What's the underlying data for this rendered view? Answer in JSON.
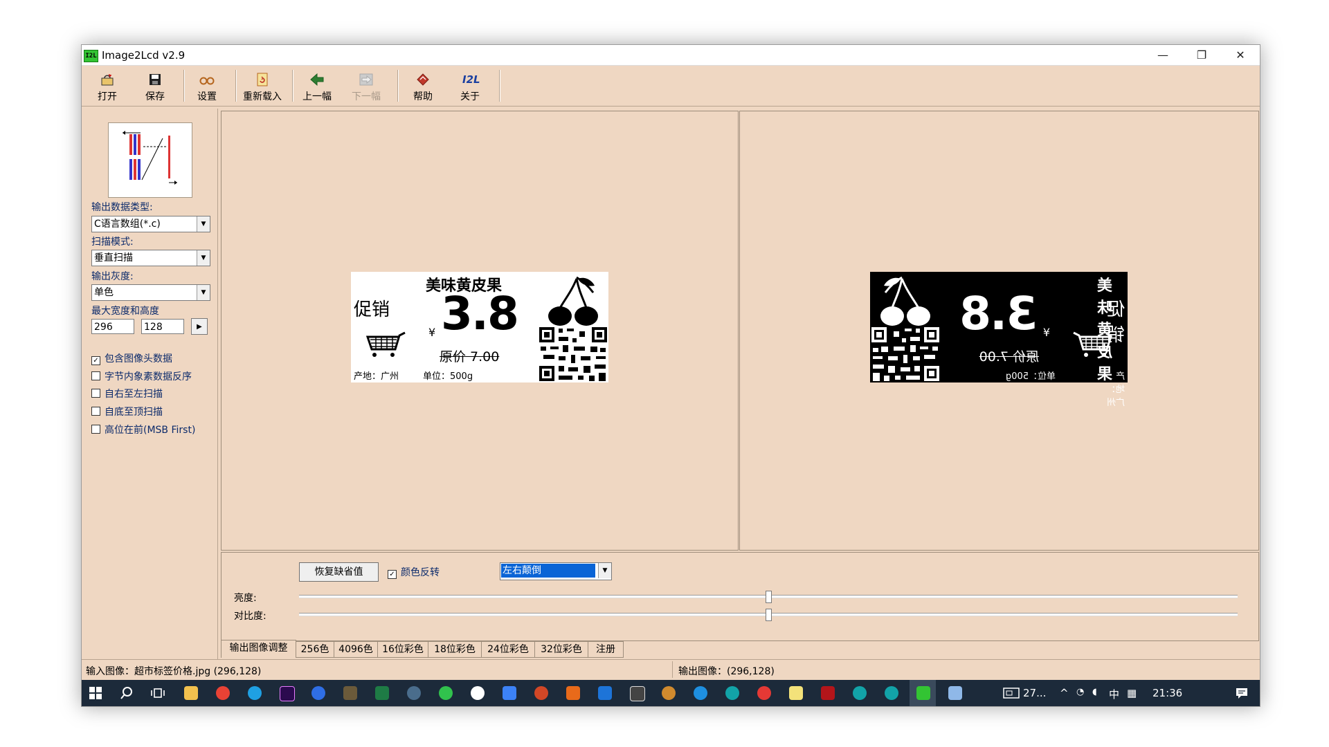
{
  "window": {
    "title": "Image2Lcd v2.9",
    "app_icon_text": "I2L",
    "controls": {
      "minimize": "—",
      "maximize": "❐",
      "close": "✕"
    }
  },
  "toolbar": {
    "open": "打开",
    "save": "保存",
    "settings": "设置",
    "reload": "重新载入",
    "prev": "上一幅",
    "next": "下一幅",
    "help": "帮助",
    "about": "关于",
    "about_icon_text": "I2L"
  },
  "left_panel": {
    "output_type_label": "输出数据类型:",
    "output_type_value": "C语言数组(*.c)",
    "scan_mode_label": "扫描模式:",
    "scan_mode_value": "垂直扫描",
    "gray_label": "输出灰度:",
    "gray_value": "单色",
    "size_label": "最大宽度和高度",
    "width": "296",
    "height": "128",
    "options": [
      {
        "label": "包含图像头数据",
        "checked": true
      },
      {
        "label": "字节内象素数据反序",
        "checked": false
      },
      {
        "label": "自右至左扫描",
        "checked": false
      },
      {
        "label": "自底至顶扫描",
        "checked": false
      },
      {
        "label": "高位在前(MSB First)",
        "checked": false
      }
    ]
  },
  "price_label": {
    "title": "美味黄皮果",
    "promo": "促销",
    "currency": "¥",
    "price": "3.8",
    "original_price": "原价 7.00",
    "origin": "产地：广州",
    "unit": "单位：500g"
  },
  "adjust": {
    "reset_button": "恢复缺省值",
    "invert_label": "颜色反转",
    "invert_checked": true,
    "flip_value": "左右颠倒",
    "brightness_label": "亮度:",
    "contrast_label": "对比度:",
    "brightness_level": 0.5,
    "contrast_level": 0.5
  },
  "tabs": [
    "输出图像调整",
    "256色",
    "4096色",
    "16位彩色",
    "18位彩色",
    "24位彩色",
    "32位彩色",
    "注册"
  ],
  "status": {
    "input": "输入图像：超市标签价格.jpg (296,128)",
    "output": "输出图像：(296,128)"
  },
  "taskbar": {
    "tray_text": "27...",
    "ime": "中",
    "clock": "21:36"
  },
  "colors": {
    "window_bg": "#efd7c2",
    "taskbar_bg": "#1c2a3a",
    "accent_green": "#33c433",
    "selection_blue": "#0a64d6"
  }
}
